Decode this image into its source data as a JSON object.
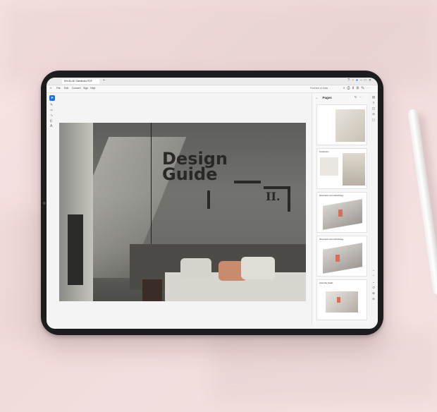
{
  "app": {
    "tab_label": "NH-BLUE-Steelbuild.PDF",
    "menu": [
      "File",
      "Edit",
      "Convert",
      "Sign",
      "Help"
    ],
    "search_placeholder": "Find text or tools",
    "window_controls": [
      "–",
      "□",
      "✕"
    ]
  },
  "document": {
    "title": "Design\nGuide",
    "section_mark": "II."
  },
  "pages_panel": {
    "header": "Pages",
    "thumbnails": [
      {
        "caption": ""
      },
      {
        "caption": "Introduction"
      },
      {
        "caption": "Dimensions and methodology"
      },
      {
        "caption": "Dimensions and methodology"
      },
      {
        "caption": "Assembly details"
      }
    ]
  },
  "icons": {
    "left_toolbar": [
      "cursor-icon",
      "comment-icon",
      "pen-icon",
      "draw-icon",
      "text-icon",
      "find-icon"
    ],
    "right_rail": [
      "pages-icon",
      "bookmark-icon",
      "layers-icon",
      "attachments-icon",
      "zoom-icon"
    ]
  },
  "colors": {
    "accent": "#1a73e8",
    "backdrop": "#f3e1e0",
    "tablet_frame": "#1d1d1f"
  }
}
